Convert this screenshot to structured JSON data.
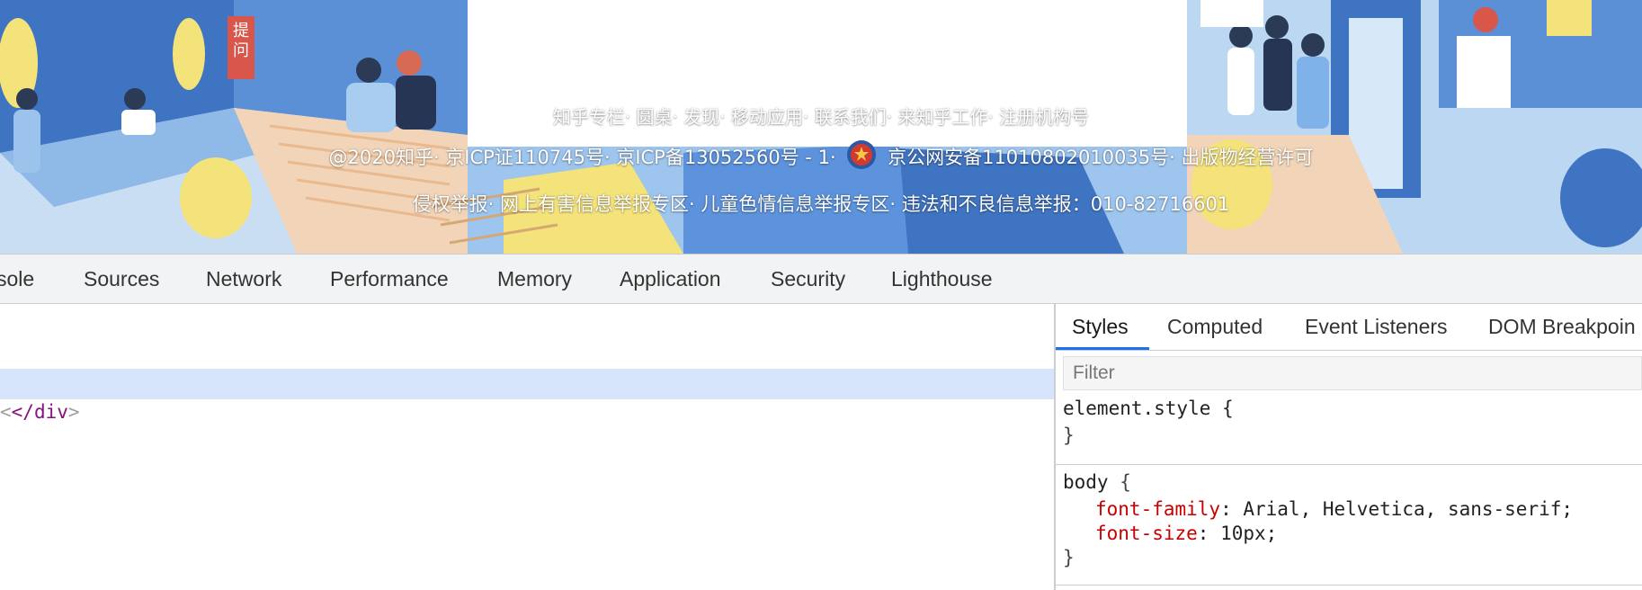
{
  "footer": {
    "line1": "知乎专栏· 圆桌· 发现· 移动应用· 联系我们· 来知乎工作· 注册机构号",
    "line2_a": "@2020知乎· 京ICP证110745号· 京ICP备13052560号 - 1·",
    "line2_b": "京公网安备11010802010035号· 出版物经营许可",
    "line3": "侵权举报· 网上有害信息举报专区· 儿童色情信息举报专区· 违法和不良信息举报：010-82716601",
    "illustration_sign": "提问"
  },
  "devtools": {
    "tabs": [
      "sole",
      "Sources",
      "Network",
      "Performance",
      "Memory",
      "Application",
      "Security",
      "Lighthouse"
    ],
    "elements": {
      "code_punct": "<",
      "code_tag": "</div",
      "code_end": ">"
    },
    "styles": {
      "tabs": [
        "Styles",
        "Computed",
        "Event Listeners",
        "DOM Breakpoin"
      ],
      "filter_placeholder": "Filter",
      "rule1_selector": "element.style {",
      "rule1_close": "}",
      "rule2_selector": "body",
      "rule2_open": " {",
      "rule2_prop1_name": "font-family",
      "rule2_prop1_value": ": Arial, Helvetica, sans-serif;",
      "rule2_prop2_name": "font-size",
      "rule2_prop2_value": ": 10px;",
      "rule2_close": "}"
    }
  },
  "colors": {
    "accent": "#1a73e8",
    "selected_row": "#d6e4fc",
    "prop_name": "#c80000",
    "tag": "#881280"
  }
}
